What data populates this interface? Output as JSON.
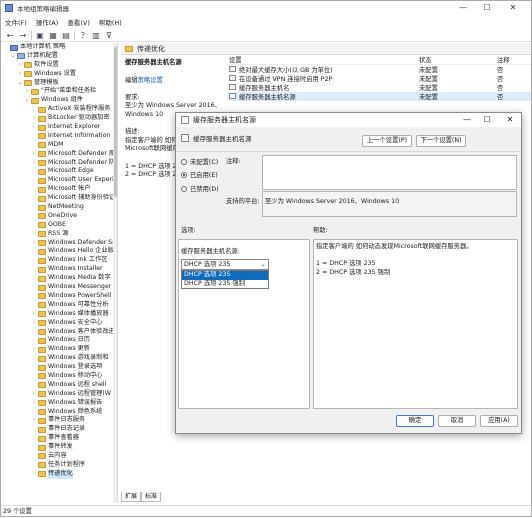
{
  "window": {
    "title": "本地组策略编辑器"
  },
  "menu": [
    "文件(F)",
    "操作(A)",
    "查看(V)",
    "帮助(H)"
  ],
  "tree": [
    {
      "label": "本地计算机 策略",
      "depth": 0,
      "exp": ""
    },
    {
      "label": "计算机配置",
      "depth": 1,
      "exp": "v"
    },
    {
      "label": "软件设置",
      "depth": 2,
      "exp": ">"
    },
    {
      "label": "Windows 设置",
      "depth": 2,
      "exp": ">"
    },
    {
      "label": "管理模板",
      "depth": 2,
      "exp": "v"
    },
    {
      "label": "\"开始\"菜单和任务栏",
      "depth": 3,
      "exp": ">"
    },
    {
      "label": "Windows 组件",
      "depth": 3,
      "exp": "v"
    },
    {
      "label": "ActiveX 安装程序服务",
      "depth": 4,
      "exp": ""
    },
    {
      "label": "BitLocker 驱动器加密",
      "depth": 4,
      "exp": ">"
    },
    {
      "label": "Internet Explorer",
      "depth": 4,
      "exp": ">"
    },
    {
      "label": "Internet Information S",
      "depth": 4,
      "exp": ""
    },
    {
      "label": "MDM",
      "depth": 4,
      "exp": ""
    },
    {
      "label": "Microsoft Defender 原",
      "depth": 4,
      "exp": ">"
    },
    {
      "label": "Microsoft Defender 防",
      "depth": 4,
      "exp": ">"
    },
    {
      "label": "Microsoft Edge",
      "depth": 4,
      "exp": ""
    },
    {
      "label": "Microsoft User Experie",
      "depth": 4,
      "exp": ""
    },
    {
      "label": "Microsoft 帐户",
      "depth": 4,
      "exp": ""
    },
    {
      "label": "Microsoft 辅助身份验证",
      "depth": 4,
      "exp": ""
    },
    {
      "label": "NetMeeting",
      "depth": 4,
      "exp": ""
    },
    {
      "label": "OneDrive",
      "depth": 4,
      "exp": ""
    },
    {
      "label": "OOBE",
      "depth": 4,
      "exp": ""
    },
    {
      "label": "RSS 源",
      "depth": 4,
      "exp": ""
    },
    {
      "label": "Windows Defender Sm",
      "depth": 4,
      "exp": ">"
    },
    {
      "label": "Windows Hello 企业版",
      "depth": 4,
      "exp": ""
    },
    {
      "label": "Windows Ink 工作区",
      "depth": 4,
      "exp": ""
    },
    {
      "label": "Windows Installer",
      "depth": 4,
      "exp": ""
    },
    {
      "label": "Windows Media 数字",
      "depth": 4,
      "exp": ""
    },
    {
      "label": "Windows Messenger",
      "depth": 4,
      "exp": ""
    },
    {
      "label": "Windows PowerShell",
      "depth": 4,
      "exp": ""
    },
    {
      "label": "Windows 可靠性分析",
      "depth": 4,
      "exp": ""
    },
    {
      "label": "Windows 媒体播放器",
      "depth": 4,
      "exp": ">"
    },
    {
      "label": "Windows 安全中心",
      "depth": 4,
      "exp": ">"
    },
    {
      "label": "Windows 客户体验改进",
      "depth": 4,
      "exp": ""
    },
    {
      "label": "Windows 日历",
      "depth": 4,
      "exp": ""
    },
    {
      "label": "Windows 更新",
      "depth": 4,
      "exp": ">"
    },
    {
      "label": "Windows 游戏录制和",
      "depth": 4,
      "exp": ""
    },
    {
      "label": "Windows 登录选项",
      "depth": 4,
      "exp": ""
    },
    {
      "label": "Windows 移动中心",
      "depth": 4,
      "exp": ""
    },
    {
      "label": "Windows 远程 shell",
      "depth": 4,
      "exp": ""
    },
    {
      "label": "Windows 远程管理(W",
      "depth": 4,
      "exp": ">"
    },
    {
      "label": "Windows 错误报告",
      "depth": 4,
      "exp": ">"
    },
    {
      "label": "Windows 颜色系统",
      "depth": 4,
      "exp": ""
    },
    {
      "label": "事件日志服务",
      "depth": 4,
      "exp": ">"
    },
    {
      "label": "事件日志记录",
      "depth": 4,
      "exp": ""
    },
    {
      "label": "事件查看器",
      "depth": 4,
      "exp": ""
    },
    {
      "label": "事件转发",
      "depth": 4,
      "exp": ""
    },
    {
      "label": "云内容",
      "depth": 4,
      "exp": ""
    },
    {
      "label": "任务计划程序",
      "depth": 4,
      "exp": ""
    },
    {
      "label": "传递优化",
      "depth": 4,
      "exp": "",
      "selected": true
    }
  ],
  "right": {
    "header": "传递优化",
    "desc_title": "缓存服务器主机名源",
    "desc_edit_prefix": "编辑",
    "desc_edit_link": "策略设置",
    "desc_req_label": "要求:",
    "desc_req_text": "至少为 Windows Server 2016、Windows 10",
    "desc_label": "描述:",
    "desc_body": "指定客户端的 如何动态发现Microsoft联网缓存",
    "desc_opt1": "1 = DHCP 选项 23",
    "desc_opt2": "2 = DHCP 选项 23"
  },
  "list": {
    "headers": [
      "设置",
      "状态",
      "注释"
    ],
    "rows": [
      {
        "name": "绝对最大缓存大小(以 GB 为单位)",
        "state": "未配置",
        "note": "否"
      },
      {
        "name": "在设备通过 VPN 连接时启用 P2P",
        "state": "未配置",
        "note": "否"
      },
      {
        "name": "缓存服务器主机名",
        "state": "未配置",
        "note": "否"
      },
      {
        "name": "缓存服务器主机名源",
        "state": "未配置",
        "note": "否",
        "selected": true
      }
    ]
  },
  "tabs": [
    "扩展",
    "标准"
  ],
  "status": "29 个设置",
  "dialog": {
    "title": "缓存服务器主机名源",
    "header": "缓存服务器主机名源",
    "prev": "上一个设置(P)",
    "next": "下一个设置(N)",
    "radios": [
      {
        "label": "未配置(C)",
        "checked": false
      },
      {
        "label": "已启用(E)",
        "checked": true
      },
      {
        "label": "已禁用(D)",
        "checked": false
      }
    ],
    "comment_label": "注释:",
    "supported_label": "支持的平台:",
    "supported_text": "至少为 Windows Server 2016、Windows 10",
    "options_label": "选项:",
    "help_label": "帮助:",
    "combo_label": "缓存服务器主机名源:",
    "combo_value": "DHCP 选项 235",
    "dropdown": [
      "DHCP 选项 235",
      "DHCP 选项 235 强制"
    ],
    "help_p1": "指定客户端的 如何动态发现Microsoft联网缓存服务器。",
    "help_p2a": "1 = DHCP 选项 235",
    "help_p2b": "2 = DHCP 选项 235 强制",
    "ok": "确定",
    "cancel": "取消",
    "apply": "应用(A)"
  }
}
